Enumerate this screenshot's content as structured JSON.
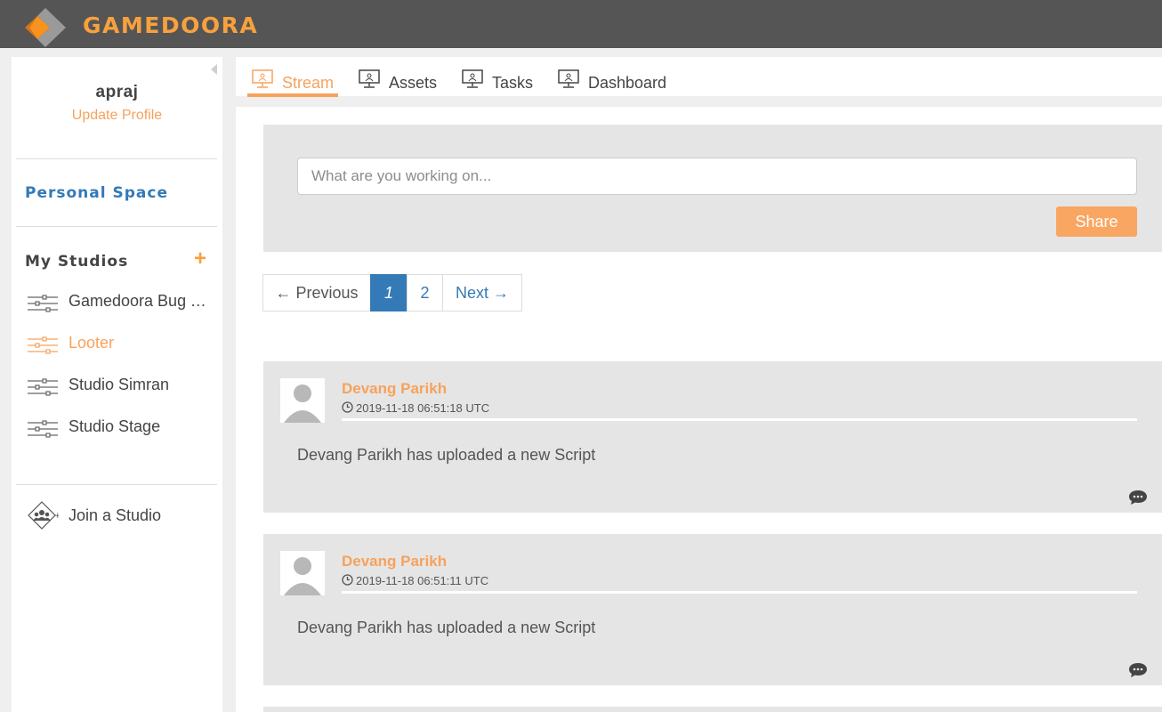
{
  "brand": {
    "name": "GAMEDOORA",
    "accent": "#f7a13e",
    "topbar_color": "#555555"
  },
  "sidebar": {
    "username": "apraj",
    "update_profile": "Update Profile",
    "personal_space": "Personal Space",
    "studios_title": "My Studios",
    "add_icon": "+",
    "studios": [
      {
        "label": "Gamedoora Bug Tracker",
        "icon": "sliders-icon",
        "active": false
      },
      {
        "label": "Looter",
        "icon": "sliders-icon",
        "active": true
      },
      {
        "label": "Studio Simran",
        "icon": "sliders-icon",
        "active": false
      },
      {
        "label": "Studio Stage",
        "icon": "sliders-icon",
        "active": false
      }
    ],
    "join_studio": "Join a Studio"
  },
  "tabs": [
    {
      "label": "Stream",
      "icon": "monitor-icon",
      "active": true
    },
    {
      "label": "Assets",
      "icon": "monitor-icon",
      "active": false
    },
    {
      "label": "Tasks",
      "icon": "monitor-icon",
      "active": false
    },
    {
      "label": "Dashboard",
      "icon": "monitor-icon",
      "active": false
    }
  ],
  "compose": {
    "placeholder": "What are you working on...",
    "share_label": "Share"
  },
  "pagination": {
    "previous": "← Previous",
    "pages": [
      "1",
      "2"
    ],
    "current": "1",
    "next": "Next →"
  },
  "posts": [
    {
      "author": "Devang Parikh",
      "time": "2019-11-18 06:51:18 UTC",
      "text": "Devang Parikh has uploaded a new Script"
    },
    {
      "author": "Devang Parikh",
      "time": "2019-11-18 06:51:11 UTC",
      "text": "Devang Parikh has uploaded a new Script"
    }
  ]
}
